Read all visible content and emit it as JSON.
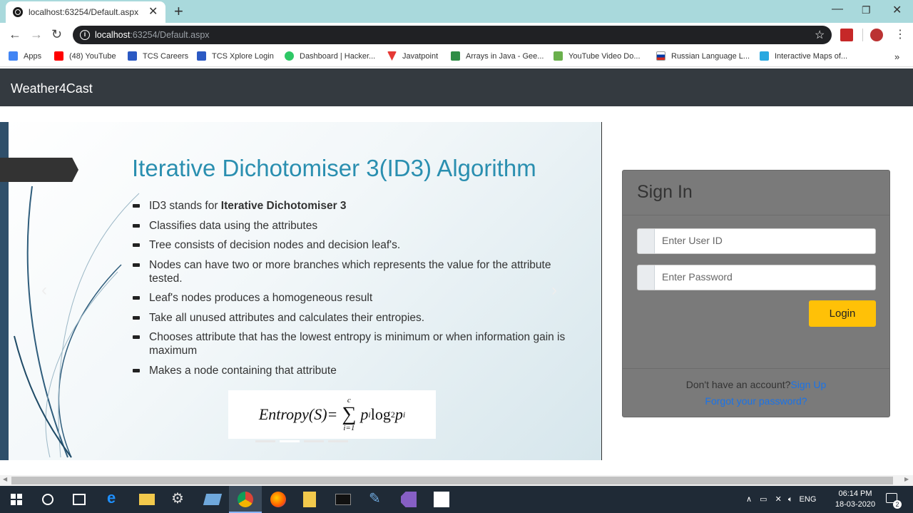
{
  "browser": {
    "tab_title": "localhost:63254/Default.aspx",
    "url_host": "localhost",
    "url_rest": ":63254/Default.aspx",
    "bookmarks": [
      {
        "label": "Apps",
        "icon": "apps-grid-icon",
        "color": "#4285f4"
      },
      {
        "label": "(48) YouTube",
        "icon": "youtube-icon",
        "color": "#ff0000"
      },
      {
        "label": "TCS Careers",
        "icon": "tcs-icon",
        "color": "#2b59c3"
      },
      {
        "label": "TCS Xplore Login",
        "icon": "tcs-icon",
        "color": "#2b59c3"
      },
      {
        "label": "Dashboard | Hacker...",
        "icon": "hackerrank-icon",
        "color": "#2ec866"
      },
      {
        "label": "Javatpoint",
        "icon": "javatpoint-icon",
        "color": "#e53935"
      },
      {
        "label": "Arrays in Java - Gee...",
        "icon": "geeksforgeeks-icon",
        "color": "#2f8d46"
      },
      {
        "label": "YouTube Video Do...",
        "icon": "download-icon",
        "color": "#6ab04c"
      },
      {
        "label": "Russian Language L...",
        "icon": "russia-flag-icon",
        "color": "#d52b1e"
      },
      {
        "label": "Interactive Maps of...",
        "icon": "maps-icon",
        "color": "#29a8e0"
      }
    ],
    "overflow": "»"
  },
  "site": {
    "brand": "Weather4Cast"
  },
  "slide": {
    "title": "Iterative Dichotomiser 3(ID3) Algorithm",
    "bullet1_prefix": "ID3 stands for ",
    "bullet1_bold": "Iterative Dichotomiser 3",
    "bullets": [
      "Classifies data using the attributes",
      "Tree consists of decision nodes and decision leaf's.",
      "Nodes can have two or more branches which represents the value for the attribute tested.",
      "Leaf's nodes produces a homogeneous result",
      "Take all unused attributes and calculates their entropies.",
      "Chooses attribute that has the lowest entropy is minimum or when information gain is maximum",
      "Makes a node containing that attribute"
    ],
    "formula": {
      "lhs": "Entropy(S)=",
      "sum_top": "c",
      "sum_bottom": "i=1",
      "rhs": "p",
      "sub_i": "i",
      "log": " log",
      "log_base": "2",
      "rhs2": " p",
      "sub_i2": "i"
    },
    "indicators": 4,
    "active_indicator": 1
  },
  "signin": {
    "title": "Sign In",
    "user_placeholder": "Enter User ID",
    "password_placeholder": "Enter Password",
    "login_label": "Login",
    "no_account": "Don't have an account?",
    "signup_label": "Sign Up",
    "forgot_label": "Forgot your password?"
  },
  "taskbar": {
    "time": "06:14 PM",
    "date": "18-03-2020",
    "lang": "ENG",
    "notif_count": "2"
  }
}
